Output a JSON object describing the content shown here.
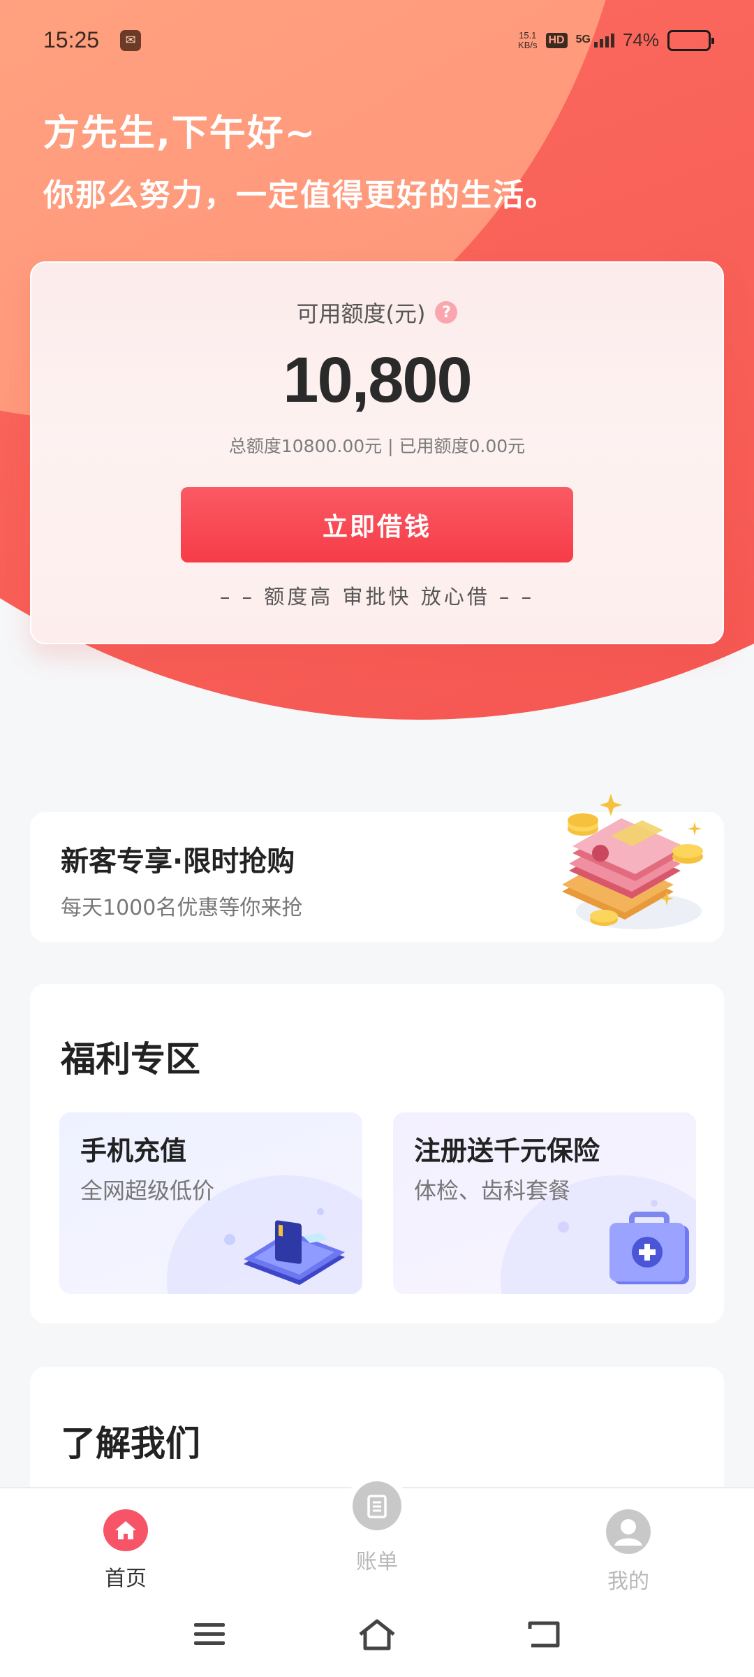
{
  "status_bar": {
    "time": "15:25",
    "net_speed_value": "15.1",
    "net_speed_unit": "KB/s",
    "hd": "HD",
    "network": "5G",
    "battery_percent": "74%",
    "battery_level": 0.74,
    "battery_color": "#5b7fe8"
  },
  "greeting": {
    "line1": "方先生,下午好~",
    "line2": "你那么努力，一定值得更好的生活。"
  },
  "credit": {
    "title": "可用额度(元)",
    "help": "?",
    "amount": "10,800",
    "summary": "总额度10800.00元 | 已用额度0.00元",
    "borrow_button": "立即借钱",
    "slogan": "– – 额度高 审批快 放心借 – –"
  },
  "promo": {
    "title": "新客专享·限时抢购",
    "subtitle": "每天1000名优惠等你来抢",
    "art_icon": "cash-stack-icon"
  },
  "welfare": {
    "title": "福利专区",
    "items": [
      {
        "title": "手机充值",
        "subtitle": "全网超级低价",
        "icon": "phone-card-icon"
      },
      {
        "title": "注册送千元保险",
        "subtitle": "体检、齿科套餐",
        "icon": "medical-kit-icon"
      }
    ]
  },
  "about": {
    "title": "了解我们"
  },
  "tabs": [
    {
      "label": "首页",
      "icon": "home-icon",
      "active": true
    },
    {
      "label": "账单",
      "icon": "bill-icon",
      "active": false
    },
    {
      "label": "我的",
      "icon": "user-icon",
      "active": false
    }
  ],
  "nav": [
    "menu-icon",
    "home-nav-icon",
    "back-icon"
  ],
  "colors": {
    "accent": "#f63c48",
    "tab_active": "#f85468",
    "tab_inactive": "#c8c8c8"
  }
}
